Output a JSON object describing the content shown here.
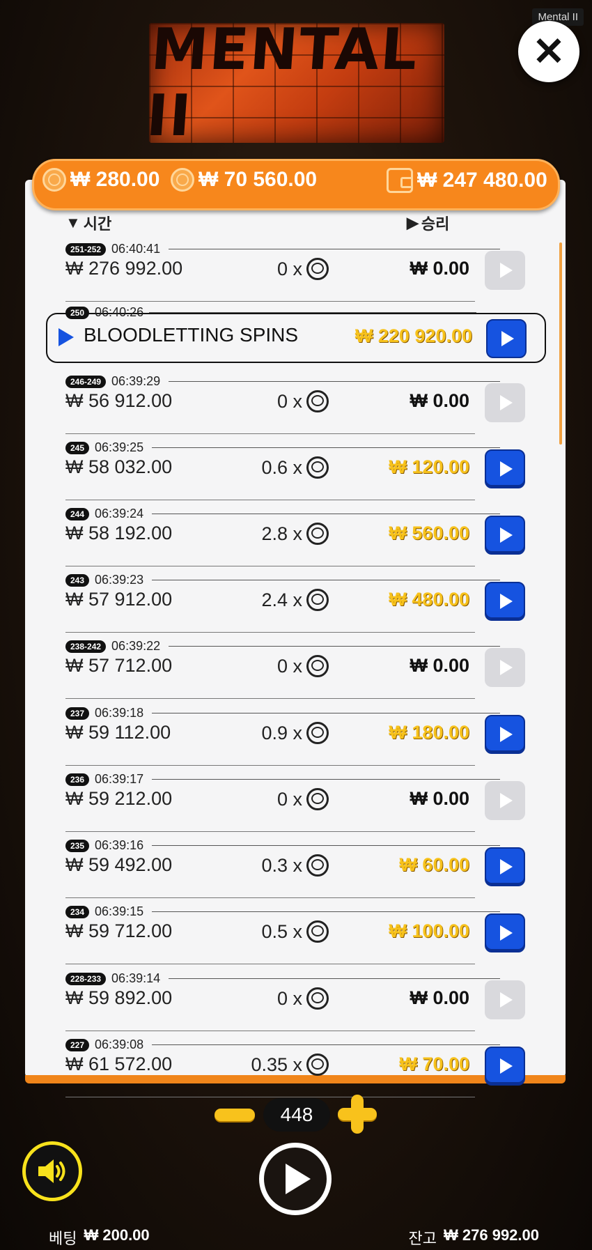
{
  "app": {
    "tag": "Mental II",
    "logo_text": "MENTAL II"
  },
  "stats": {
    "value1": "₩ 280.00",
    "value2": "₩ 70 560.00",
    "balance": "₩ 247 480.00"
  },
  "headers": {
    "time": "시간",
    "win": "승리"
  },
  "bonus": {
    "badge": "250",
    "time": "06:40:26",
    "label": "BLOODLETTING SPINS",
    "win": "₩ 220 920.00"
  },
  "rows": [
    {
      "badge": "251-252",
      "time": "06:40:41",
      "bet": "₩ 276 992.00",
      "mult": "0 x",
      "win": "₩ 0.00"
    },
    {
      "badge": "246-249",
      "time": "06:39:29",
      "bet": "₩ 56 912.00",
      "mult": "0 x",
      "win": "₩ 0.00"
    },
    {
      "badge": "245",
      "time": "06:39:25",
      "bet": "₩ 58 032.00",
      "mult": "0.6 x",
      "win": "₩ 120.00"
    },
    {
      "badge": "244",
      "time": "06:39:24",
      "bet": "₩ 58 192.00",
      "mult": "2.8 x",
      "win": "₩ 560.00"
    },
    {
      "badge": "243",
      "time": "06:39:23",
      "bet": "₩ 57 912.00",
      "mult": "2.4 x",
      "win": "₩ 480.00"
    },
    {
      "badge": "238-242",
      "time": "06:39:22",
      "bet": "₩ 57 712.00",
      "mult": "0 x",
      "win": "₩ 0.00"
    },
    {
      "badge": "237",
      "time": "06:39:18",
      "bet": "₩ 59 112.00",
      "mult": "0.9 x",
      "win": "₩ 180.00"
    },
    {
      "badge": "236",
      "time": "06:39:17",
      "bet": "₩ 59 212.00",
      "mult": "0 x",
      "win": "₩ 0.00"
    },
    {
      "badge": "235",
      "time": "06:39:16",
      "bet": "₩ 59 492.00",
      "mult": "0.3 x",
      "win": "₩ 60.00"
    },
    {
      "badge": "234",
      "time": "06:39:15",
      "bet": "₩ 59 712.00",
      "mult": "0.5 x",
      "win": "₩ 100.00"
    },
    {
      "badge": "228-233",
      "time": "06:39:14",
      "bet": "₩ 59 892.00",
      "mult": "0 x",
      "win": "₩ 0.00"
    },
    {
      "badge": "227",
      "time": "06:39:08",
      "bet": "₩ 61 572.00",
      "mult": "0.35 x",
      "win": "₩ 70.00"
    }
  ],
  "controls": {
    "counter": "448"
  },
  "footer": {
    "bet_label": "베팅",
    "bet_value": "₩ 200.00",
    "balance_label": "잔고",
    "balance_value": "₩ 276 992.00"
  },
  "colors": {
    "accent": "#f7871c",
    "play_blue": "#1653e0",
    "win_gold": "#f7c21c"
  }
}
